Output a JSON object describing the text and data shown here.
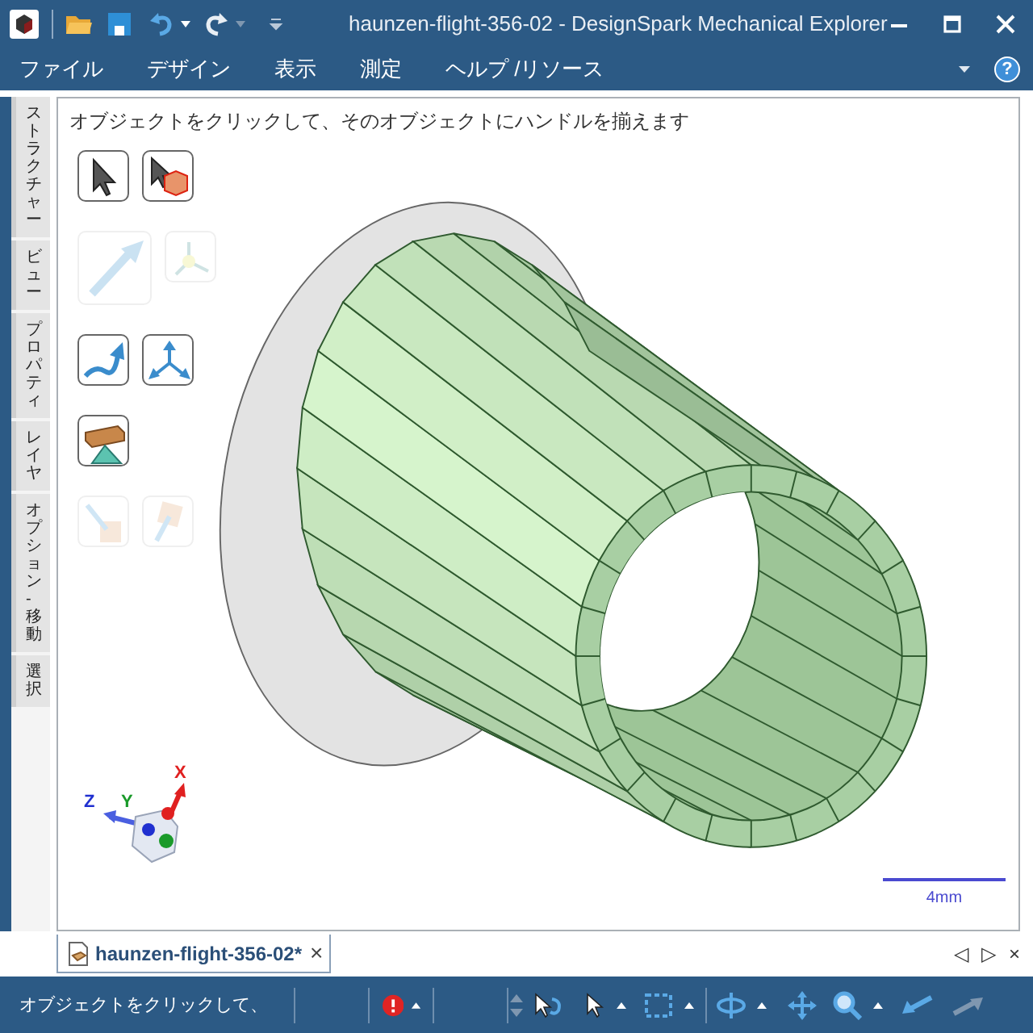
{
  "window": {
    "title": "haunzen-flight-356-02 - DesignSpark Mechanical Explorer"
  },
  "menu": [
    "ファイル",
    "デザイン",
    "表示",
    "測定",
    "ヘルプ /リソース"
  ],
  "help": "?",
  "side_tabs": [
    "ストラクチャー",
    "ビュー",
    "プロパティ",
    "レイヤ",
    "オプション - 移動",
    "選択"
  ],
  "viewport": {
    "hint": "オブジェクトをクリックして、そのオブジェクトにハンドルを揃えます",
    "tool_rows": [
      [
        {
          "kind": "select",
          "disabled": false
        },
        {
          "kind": "select-body",
          "disabled": false
        }
      ],
      [
        {
          "kind": "pull",
          "disabled": true
        },
        {
          "kind": "anchor",
          "disabled": true
        }
      ],
      [
        {
          "kind": "path",
          "disabled": false
        },
        {
          "kind": "axes",
          "disabled": false
        }
      ],
      [
        {
          "kind": "beam",
          "disabled": false
        }
      ],
      [
        {
          "kind": "drop",
          "disabled": true
        },
        {
          "kind": "lift",
          "disabled": true
        }
      ]
    ],
    "axes": {
      "x": "X",
      "y": "Y",
      "z": "Z"
    },
    "scale": "4mm"
  },
  "document_tab": {
    "label": "haunzen-flight-356-02*",
    "close": "×"
  },
  "tab_nav": [
    "◁",
    "▷",
    "×"
  ],
  "status_bar": {
    "message": "オブジェクトをクリックして、"
  }
}
